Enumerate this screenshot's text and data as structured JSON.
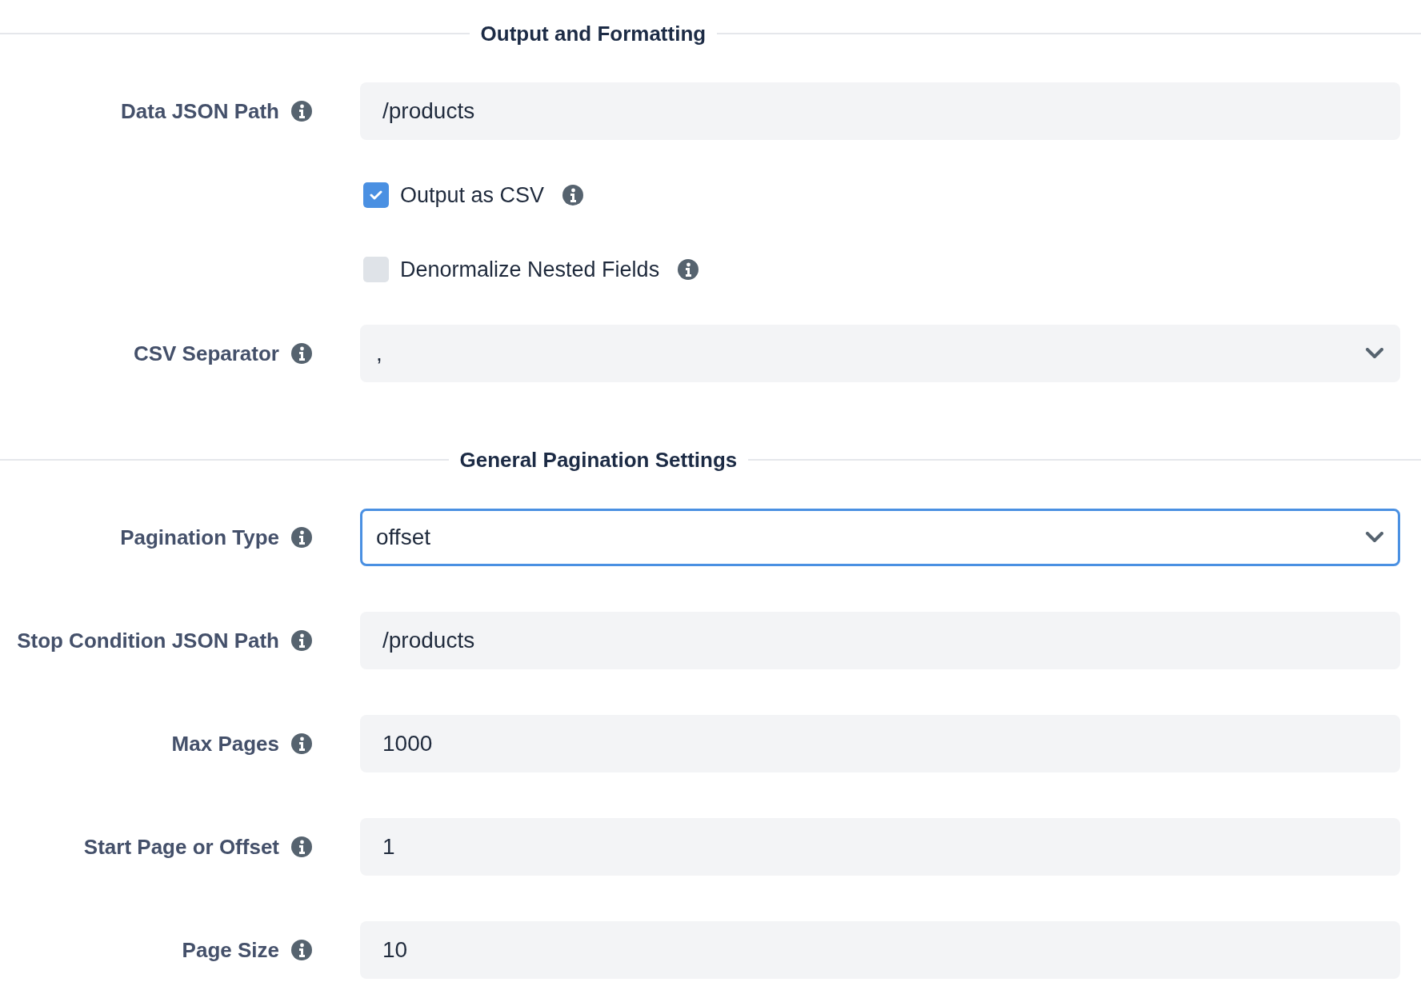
{
  "sections": [
    {
      "title": "Output and Formatting",
      "rows": [
        {
          "kind": "text",
          "label": "Data JSON Path",
          "value": "/products"
        },
        {
          "kind": "checkbox",
          "label": "Output as CSV",
          "checked": true
        },
        {
          "kind": "checkbox",
          "label": "Denormalize Nested Fields",
          "checked": false
        },
        {
          "kind": "select",
          "label": "CSV Separator",
          "value": ",",
          "focused": false
        }
      ]
    },
    {
      "title": "General Pagination Settings",
      "rows": [
        {
          "kind": "select",
          "label": "Pagination Type",
          "value": "offset",
          "focused": true
        },
        {
          "kind": "text",
          "label": "Stop Condition JSON Path",
          "value": "/products"
        },
        {
          "kind": "text",
          "label": "Max Pages",
          "value": "1000"
        },
        {
          "kind": "text",
          "label": "Start Page or Offset",
          "value": "1"
        },
        {
          "kind": "text",
          "label": "Page Size",
          "value": "10"
        }
      ]
    }
  ]
}
